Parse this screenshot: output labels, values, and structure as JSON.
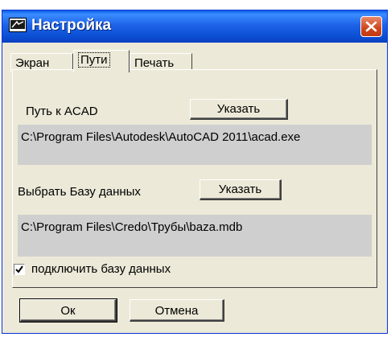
{
  "window": {
    "title": "Настройка",
    "icon": "acad-app-icon",
    "close_icon": "close-icon"
  },
  "tabs": [
    {
      "label": "Экран",
      "active": false
    },
    {
      "label": "Пути",
      "active": true
    },
    {
      "label": "Печать",
      "active": false
    }
  ],
  "acad": {
    "label": "Путь к ACAD",
    "button_label": "Указать",
    "path": "C:\\Program Files\\Autodesk\\AutoCAD 2011\\acad.exe"
  },
  "database": {
    "label": "Выбрать Базу данных",
    "button_label": "Указать",
    "path": "C:\\Program Files\\Credo\\Трубы\\baza.mdb"
  },
  "connect_db": {
    "label": "подключить базу данных",
    "checked": true
  },
  "footer": {
    "ok_label": "Ок",
    "cancel_label": "Отмена"
  },
  "colors": {
    "titlebar": "#0b4fd4",
    "close_button": "#d2451c",
    "dialog_bg": "#ece9d8",
    "path_box_bg": "#cfcfcf"
  }
}
